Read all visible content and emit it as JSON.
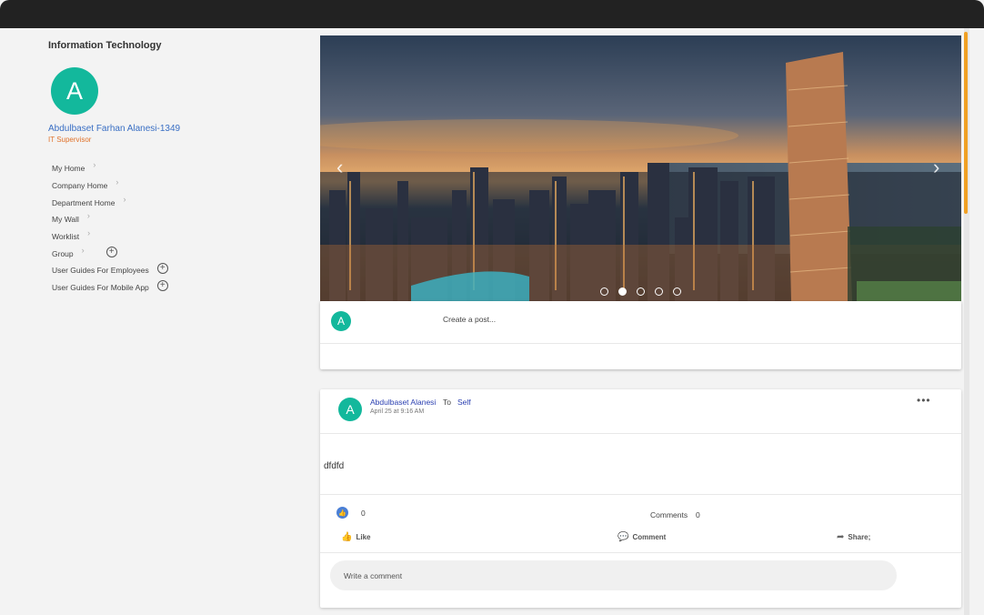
{
  "sidebar": {
    "department": "Information Technology",
    "avatar_letter": "A",
    "user_name": "Abdulbaset Farhan Alanesi-1349",
    "user_role": "IT Supervisor",
    "nav": [
      {
        "label": "My Home",
        "icon": "chevron-right-icon"
      },
      {
        "label": "Company Home",
        "icon": "chevron-right-icon"
      },
      {
        "label": "Department Home",
        "icon": "chevron-right-icon"
      },
      {
        "label": "My Wall",
        "icon": "chevron-right-icon"
      },
      {
        "label": "Worklist",
        "icon": "chevron-right-icon"
      },
      {
        "label": "Group",
        "icon": "chevron-right-icon",
        "extra_icon": "plus-circle-icon"
      },
      {
        "label": "User Guides For Employees",
        "icon": "plus-circle-icon"
      },
      {
        "label": "User Guides For Mobile App",
        "icon": "plus-circle-icon"
      }
    ]
  },
  "carousel": {
    "slide_count": 5,
    "active_index": 1
  },
  "composer": {
    "avatar_letter": "A",
    "placeholder": "Create a post..."
  },
  "post": {
    "avatar_letter": "A",
    "author": "Abdulbaset Alanesi",
    "to_label": "To",
    "target": "Self",
    "timestamp": "April 25 at 9:16 AM",
    "more_label": "•••",
    "body": "dfdfd",
    "like_count": "0",
    "comments_label": "Comments",
    "comments_count": "0",
    "actions": {
      "like": "Like",
      "comment": "Comment",
      "share": "Share;"
    },
    "comment_placeholder": "Write a comment"
  },
  "colors": {
    "accent_teal": "#13b89c",
    "link_blue": "#2a3fb0",
    "role_orange": "#e0722a",
    "scroll_orange": "#f0a024"
  }
}
